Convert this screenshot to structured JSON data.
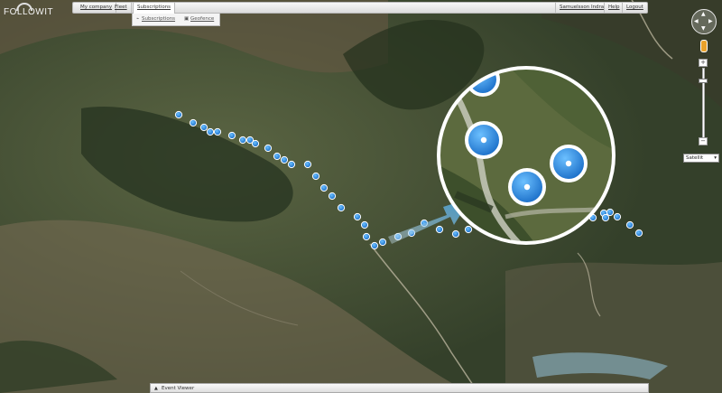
{
  "app": {
    "logo_text": "FOLLOWIT"
  },
  "menu": {
    "items": [
      {
        "label": "My company"
      },
      {
        "label": "Fleet"
      },
      {
        "label": "Subscriptions",
        "active": true
      }
    ],
    "user_name": "Samuelsson Indra",
    "help_label": "Help",
    "logout_label": "Logout"
  },
  "submenu": {
    "subscriptions_label": "Subscriptions",
    "geofence_label": "Geofence"
  },
  "map_controls": {
    "zoom_in": "+",
    "zoom_out": "−",
    "map_type": "Satellit"
  },
  "event_viewer": {
    "label": "Event Viewer"
  },
  "colors": {
    "marker_fill": "#2f8ee6",
    "marker_ring": "#ffffff",
    "arrow": "#5aaee0"
  },
  "icons": {
    "subscriptions": "subscriptions-icon",
    "geofence": "geofence-icon",
    "pegman": "street-view-icon",
    "pan": "pan-control-icon"
  }
}
